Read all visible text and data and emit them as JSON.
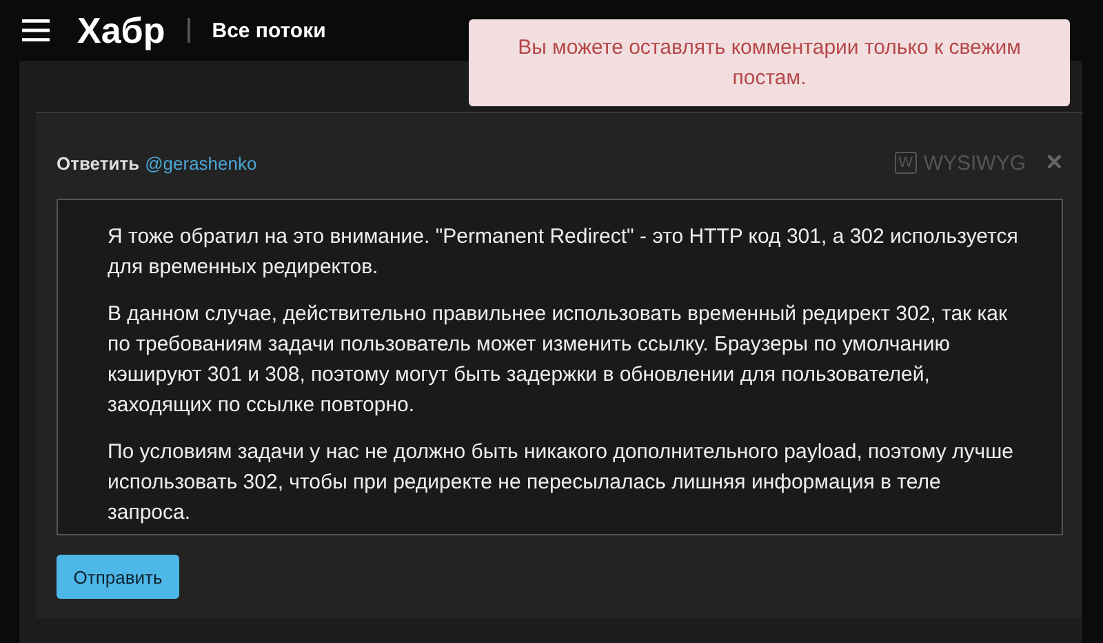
{
  "header": {
    "logo": "Хабр",
    "section": "Все потоки"
  },
  "toast": {
    "message": "Вы можете оставлять комментарии только к свежим постам."
  },
  "reply": {
    "label": "Ответить",
    "mention": "@gerashenko",
    "wysiwyg_icon": "W",
    "wysiwyg_label": "WYSIWYG",
    "close": "✕",
    "paragraphs": [
      "Я тоже обратил на это внимание. \"Permanent Redirect\" - это HTTP код 301, а 302 используется для временных редиректов.",
      "В данном случае, действительно правильнее использовать временный редирект 302, так как по требованиям задачи пользователь может изменить ссылку. Браузеры по умолчанию кэшируют 301 и 308, поэтому могут быть задержки в обновлении для пользователей, заходящих по ссылке повторно.",
      "По условиям задачи у нас не должно быть никакого дополнительного payload, поэтому лучше использовать 302, чтобы при редиректе не пересылалась лишняя информация в теле запроса."
    ],
    "submit": "Отправить"
  }
}
